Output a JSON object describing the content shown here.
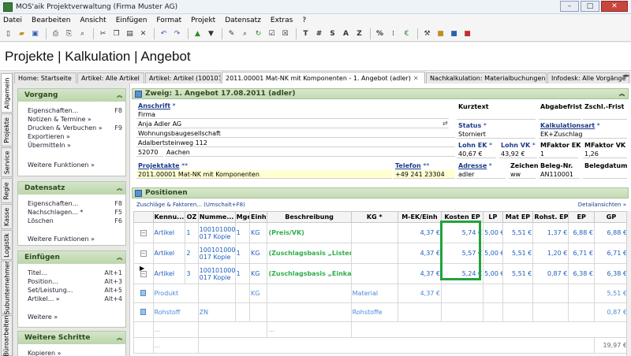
{
  "window": {
    "title": "MOS'aik Projektverwaltung (Firma Muster AG)",
    "min": "–",
    "max": "□",
    "close": "✕"
  },
  "menu": [
    "Datei",
    "Bearbeiten",
    "Ansicht",
    "Einfügen",
    "Format",
    "Projekt",
    "Datensatz",
    "Extras",
    "?"
  ],
  "toolbar": {
    "text_buttons": [
      "T",
      "#",
      "S",
      "A",
      "Z",
      "%"
    ],
    "icons": [
      "new-doc-icon",
      "open-folder-icon",
      "save-icon",
      "print-icon",
      "print-preview-icon",
      "preview-icon",
      "cut-icon",
      "copy-icon",
      "paste-icon",
      "delete-icon",
      "undo-icon",
      "redo-icon",
      "arrow-up-icon",
      "arrow-down-icon",
      "edit-icon",
      "search-icon",
      "refresh-icon",
      "check-icon",
      "check-all-icon",
      "decimals-icon",
      "currency-icon",
      "tools-icon",
      "lock-yellow-icon",
      "lock-blue-icon",
      "lock-red-icon"
    ]
  },
  "page_title": "Projekte | Kalkulation | Angebot",
  "doc_tabs": [
    {
      "label": "Home: Startseite",
      "active": false
    },
    {
      "label": "Artikel: Alle Artikel",
      "active": false
    },
    {
      "label": "Artikel: Artikel (100101...",
      "active": false
    },
    {
      "label": "2011.00001 Mat-NK mit Komponenten - 1. Angebot (adler)",
      "active": true
    },
    {
      "label": "Nachkalkulation: Materialbuchungen",
      "active": false
    },
    {
      "label": "Infodesk: Alle Vorgänge",
      "active": false
    }
  ],
  "vertical_tabs": [
    "Allgemein",
    "Projekte",
    "Service",
    "Regie",
    "Kasse",
    "Logistik",
    "Subunternehmer",
    "Büroarbeiten"
  ],
  "sidebar": {
    "vorgang": {
      "title": "Vorgang",
      "items": [
        {
          "label": "Eigenschaften...",
          "key": "F8"
        },
        {
          "label": "Notizen & Termine »",
          "key": ""
        },
        {
          "label": "Drucken & Verbuchen »",
          "key": "F9"
        },
        {
          "label": "Exportieren »",
          "key": ""
        },
        {
          "label": "Übermitteln »",
          "key": ""
        }
      ],
      "more": "Weitere Funktionen »"
    },
    "datensatz": {
      "title": "Datensatz",
      "items": [
        {
          "label": "Eigenschaften...",
          "key": "F8"
        },
        {
          "label": "Nachschlagen... *",
          "key": "F5"
        },
        {
          "label": "Löschen",
          "key": "F6"
        }
      ],
      "more": "Weitere Funktionen »"
    },
    "einfuegen": {
      "title": "Einfügen",
      "items": [
        {
          "label": "Titel...",
          "key": "Alt+1"
        },
        {
          "label": "Position...",
          "key": "Alt+3"
        },
        {
          "label": "Set/Leistung...",
          "key": "Alt+5"
        },
        {
          "label": "Artikel... »",
          "key": "Alt+4"
        }
      ],
      "more": "Weitere »"
    },
    "schritte": {
      "title": "Weitere Schritte",
      "items": [
        {
          "label": "Kopieren »",
          "key": ""
        }
      ]
    }
  },
  "zweig": {
    "title": "Zweig: 1. Angebot 17.08.2011 (adler)"
  },
  "form": {
    "anschrift_label": "Anschrift",
    "anschrift_lines": [
      "Firma",
      "Anja Adler AG",
      "Wohnungsbaugesellschaft",
      "Adalbertsteinweg 112"
    ],
    "plz": "52070",
    "ort": "Aachen",
    "kurztext_label": "Kurztext",
    "abgabefrist_label": "Abgabefrist",
    "zschl_frist_label": "Zschl.-Frist",
    "status_label": "Status",
    "status_value": "Storniert",
    "kalkart_label": "Kalkulationsart",
    "kalkart_value": "EK+Zuschlag",
    "lohn_ek_label": "Lohn EK",
    "lohn_ek_value": "40,67 €",
    "lohn_vk_label": "Lohn VK",
    "lohn_vk_value": "43,92 €",
    "mfaktor_ek_label": "MFaktor EK",
    "mfaktor_ek_value": "1",
    "mfaktor_vk_label": "MFaktor VK",
    "mfaktor_vk_value": "1,26",
    "projektakte_label": "Projektakte",
    "projektakte_value": "2011.00001 Mat-NK mit Komponenten",
    "telefon_label": "Telefon",
    "telefon_value": "+49 241 23304",
    "adresse_label": "Adresse",
    "adresse_value": "adler",
    "zeichen_label": "Zeichen",
    "zeichen_value": "ww",
    "belegnr_label": "Beleg-Nr.",
    "belegnr_value": "AN110001",
    "belegdatum_label": "Belegdatum",
    "stars": "*",
    "double_stars": "**"
  },
  "positionen": {
    "title": "Positionen",
    "zuschlaege_link": "Zuschläge & Faktoren... (Umschalt+F8)",
    "details_link": "Detailansichten »",
    "columns": [
      "",
      "Kennu...",
      "OZ",
      "Numme...",
      "Mge",
      "Einh",
      "Beschreibung",
      "KG *",
      "M-EK/Einh",
      "Kosten EP",
      "LP",
      "Mat EP",
      "Rohst. EP",
      "EP",
      "GP"
    ],
    "rows": [
      {
        "kennung": "Artikel",
        "oz": "1",
        "nummer": "100101000 017 Kopie",
        "mge": "1",
        "einh": "KG",
        "beschreibung": "(Preis/VK)",
        "kg": "",
        "mek": "4,37 €",
        "kosten_ep": "5,74 €",
        "lp": "5,00 €",
        "mat_ep": "5,51 €",
        "rohst_ep": "1,37 €",
        "ep": "6,88 €",
        "gp": "6,88 €"
      },
      {
        "kennung": "Artikel",
        "oz": "2",
        "nummer": "100101000 017 Kopie",
        "mge": "1",
        "einh": "KG",
        "beschreibung": "(Zuschlagsbasis „Listenpreis“)",
        "kg": "",
        "mek": "4,37 €",
        "kosten_ep": "5,57 €",
        "lp": "5,00 €",
        "mat_ep": "5,51 €",
        "rohst_ep": "1,20 €",
        "ep": "6,71 €",
        "gp": "6,71 €"
      },
      {
        "kennung": "Artikel",
        "oz": "3",
        "nummer": "100101000 017 Kopie",
        "mge": "1",
        "einh": "KG",
        "beschreibung": "(Zuschlagsbasis „Einkaufspreis“)",
        "kg": "",
        "mek": "4,37 €",
        "kosten_ep": "5,24 €",
        "lp": "5,00 €",
        "mat_ep": "5,51 €",
        "rohst_ep": "0,87 €",
        "ep": "6,38 €",
        "gp": "6,38 €"
      }
    ],
    "sub_rows": [
      {
        "kennung": "Produkt",
        "nummer": "",
        "einh": "KG",
        "kg": "Material",
        "mek": "4,37 €",
        "gp": "5,51 €"
      },
      {
        "kennung": "Rohstoff",
        "nummer": "ZN",
        "einh": "",
        "kg": "Rohstoffe",
        "mek": "",
        "gp": "0,87 €"
      }
    ],
    "empty_row_marker": "...",
    "total": "19,97 €"
  },
  "colors": {
    "accent_green": "#22a23c",
    "link_blue": "#1a3a8a",
    "header_green": "#c4dab4"
  }
}
